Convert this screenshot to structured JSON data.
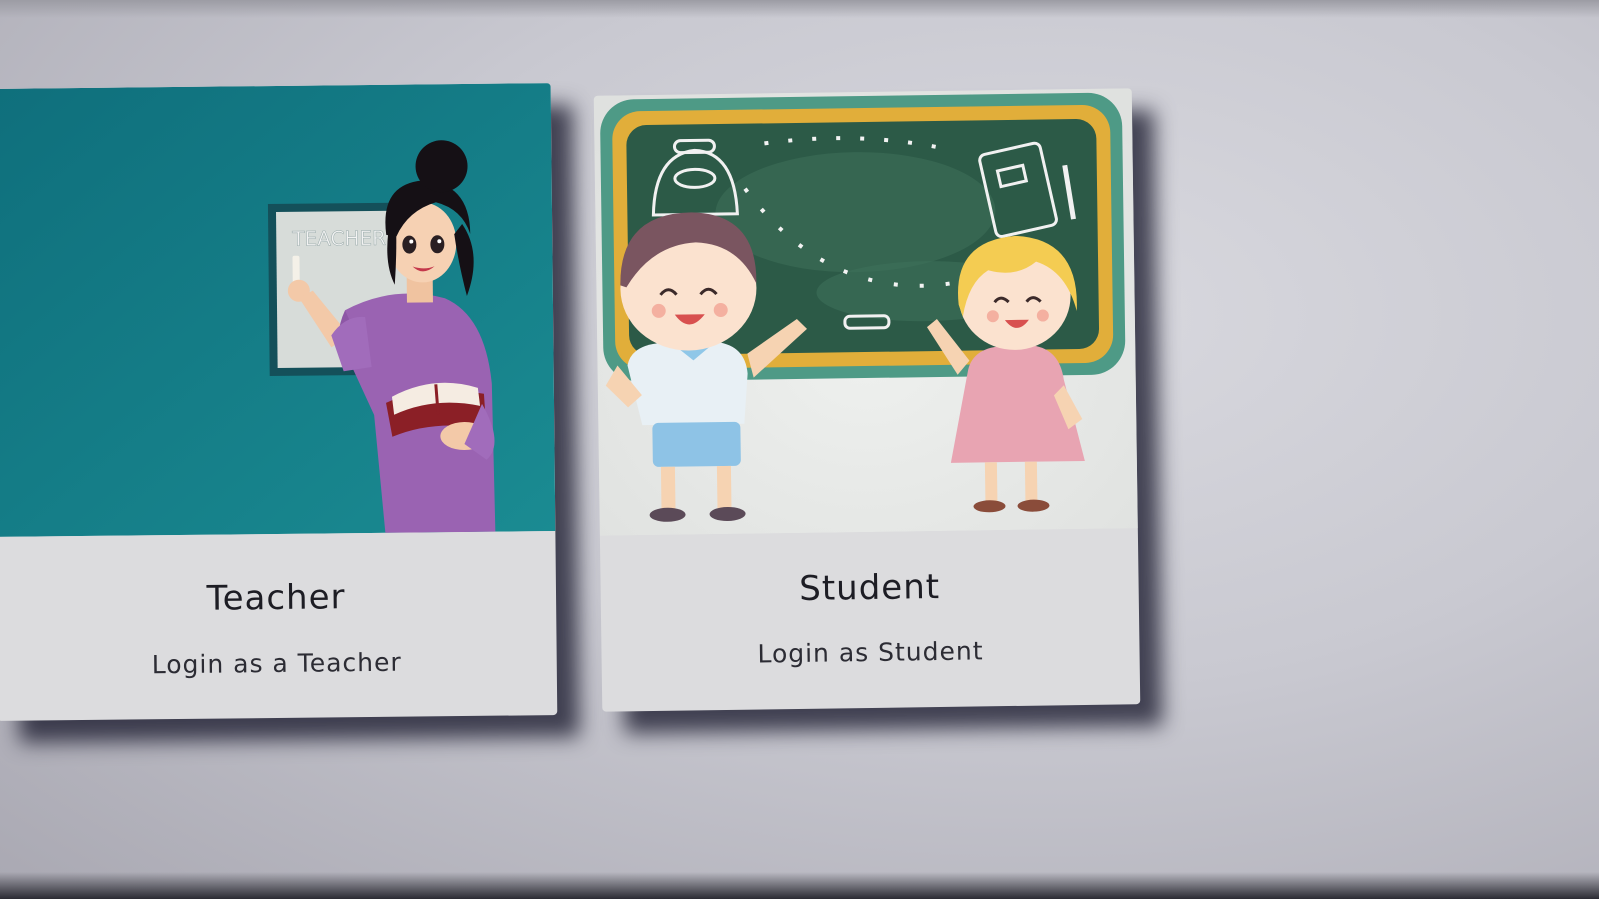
{
  "cards": [
    {
      "title": "Teacher",
      "subtitle": "Login as a Teacher",
      "board_text": "TEACHER"
    },
    {
      "title": "Student",
      "subtitle": "Login as Student"
    }
  ],
  "colors": {
    "teacher_background": "#13808a",
    "chalkboard": "#2c5a47",
    "card_body": "#dcdcde"
  }
}
